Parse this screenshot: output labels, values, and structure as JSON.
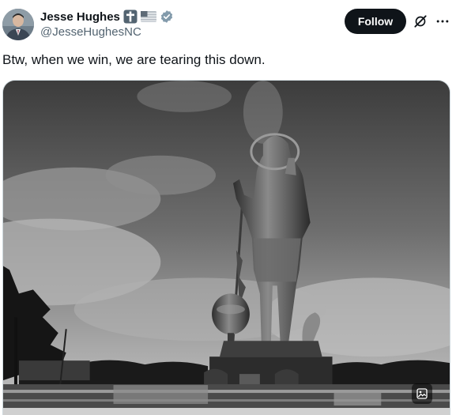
{
  "author": {
    "display_name": "Jesse Hughes",
    "handle": "@JesseHughesNC",
    "badges": [
      "cross-icon",
      "us-flag-icon",
      "verified-badge-icon"
    ]
  },
  "actions": {
    "follow_label": "Follow",
    "grok_icon": "grok-icon",
    "more_icon": "more-options-icon"
  },
  "tweet": {
    "text": "Btw, when we win, we are tearing this down."
  },
  "media": {
    "kind": "photo",
    "tone": "grayscale",
    "subject": "statue",
    "overlay_icon": "image-edit-icon"
  },
  "colors": {
    "text_primary": "#0f1419",
    "text_secondary": "#536471",
    "follow_bg": "#0f1419",
    "follow_text": "#ffffff",
    "verified_badge": "#829aab",
    "border": "#cfd9de"
  }
}
